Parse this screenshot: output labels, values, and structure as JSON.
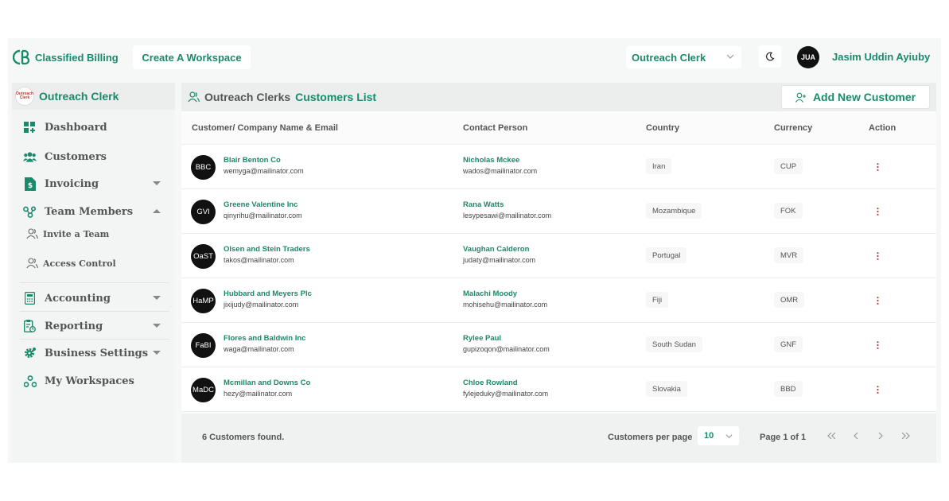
{
  "brand": {
    "name": "Classified Billing"
  },
  "topbar": {
    "create_workspace": "Create A Workspace",
    "org_select": "Outreach Clerk",
    "user_initials": "JUA",
    "user_name": "Jasim Uddin Ayiuby"
  },
  "sidebar": {
    "workspace_name": "Outreach Clerk",
    "workspace_logo_text": "Outreach Clerk",
    "items": [
      {
        "label": "Dashboard",
        "icon": "dashboard-icon"
      },
      {
        "label": "Customers",
        "icon": "customers-icon"
      },
      {
        "label": "Invoicing",
        "icon": "invoice-icon"
      },
      {
        "label": "Team Members",
        "icon": "team-icon"
      },
      {
        "label": "Accounting",
        "icon": "calculator-icon"
      },
      {
        "label": "Reporting",
        "icon": "report-icon"
      },
      {
        "label": "Business Settings",
        "icon": "gear-icon"
      },
      {
        "label": "My Workspaces",
        "icon": "workspaces-icon"
      }
    ],
    "sub_items": [
      {
        "label": "Invite a Team"
      },
      {
        "label": "Access Control"
      }
    ]
  },
  "main": {
    "title_prefix": "Outreach Clerks",
    "title": "Customers List",
    "add_button": "Add New Customer",
    "columns": [
      "Customer/ Company Name & Email",
      "Contact Person",
      "Country",
      "Currency",
      "Action"
    ],
    "rows": [
      {
        "initials": "BBC",
        "company": "Blair Benton Co",
        "email": "wemyga@mailinator.com",
        "contact": "Nicholas Mckee",
        "contact_email": "wados@mailinator.com",
        "country": "Iran",
        "currency": "CUP"
      },
      {
        "initials": "GVI",
        "company": "Greene Valentine Inc",
        "email": "qinyrihu@mailinator.com",
        "contact": "Rana Watts",
        "contact_email": "lesypesawi@mailinator.com",
        "country": "Mozambique",
        "currency": "FOK"
      },
      {
        "initials": "OaST",
        "company": "Olsen and Stein Traders",
        "email": "takos@mailinator.com",
        "contact": "Vaughan Calderon",
        "contact_email": "judaty@mailinator.com",
        "country": "Portugal",
        "currency": "MVR"
      },
      {
        "initials": "HaMP",
        "company": "Hubbard and Meyers Plc",
        "email": "jixijudy@mailinator.com",
        "contact": "Malachi Moody",
        "contact_email": "mohisehu@mailinator.com",
        "country": "Fiji",
        "currency": "OMR"
      },
      {
        "initials": "FaBI",
        "company": "Flores and Baldwin Inc",
        "email": "waga@mailinator.com",
        "contact": "Rylee Paul",
        "contact_email": "gupizoqon@mailinator.com",
        "country": "South Sudan",
        "currency": "GNF"
      },
      {
        "initials": "MaDC",
        "company": "Mcmillan and Downs Co",
        "email": "hezy@mailinator.com",
        "contact": "Chloe Rowland",
        "contact_email": "fylejeduky@mailinator.com",
        "country": "Slovakia",
        "currency": "BBD"
      }
    ]
  },
  "footer": {
    "found": "6 Customers found.",
    "per_page_label": "Customers per page",
    "per_page_value": "10",
    "page_info": "Page 1 of 1"
  },
  "colors": {
    "accent": "#1a8a6a",
    "action_dots": "#c0392b"
  }
}
